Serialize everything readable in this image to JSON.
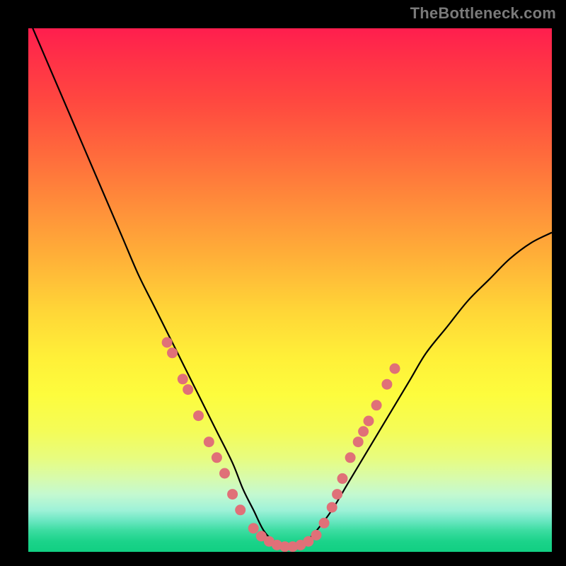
{
  "watermark": "TheBottleneck.com",
  "colors": {
    "watermark_text": "#7a7a7a",
    "frame_background": "#000000",
    "curve_stroke": "#000000",
    "dot_fill": "#e07078",
    "gradient_stops": [
      "#ff1e4e",
      "#ff3147",
      "#ff4840",
      "#ff6a3c",
      "#ff8e3a",
      "#ffb138",
      "#ffd637",
      "#fff038",
      "#fdfc3d",
      "#f4fc58",
      "#e8fc7e",
      "#d7fbad",
      "#c4f9d0",
      "#9ff2d8",
      "#6ce7c2",
      "#3adca0",
      "#1bd38a",
      "#11cf82"
    ]
  },
  "chart_data": {
    "type": "line",
    "title": "",
    "xlabel": "",
    "ylabel": "",
    "xlim": [
      0,
      100
    ],
    "ylim": [
      0,
      100
    ],
    "grid": false,
    "legend": false,
    "series": [
      {
        "name": "bottleneck-curve",
        "x": [
          0,
          3,
          6,
          9,
          12,
          15,
          18,
          21,
          24,
          27,
          30,
          33,
          36,
          39,
          41,
          43,
          45,
          47,
          49,
          51,
          53,
          55,
          58,
          61,
          64,
          67,
          70,
          73,
          76,
          80,
          84,
          88,
          92,
          96,
          100
        ],
        "y": [
          102,
          95,
          88,
          81,
          74,
          67,
          60,
          53,
          47,
          41,
          35,
          29,
          23,
          17,
          12,
          8,
          4,
          2,
          1,
          1,
          2,
          4,
          8,
          13,
          18,
          23,
          28,
          33,
          38,
          43,
          48,
          52,
          56,
          59,
          61
        ]
      }
    ],
    "markers": [
      {
        "x": 26.5,
        "y": 40
      },
      {
        "x": 27.5,
        "y": 38
      },
      {
        "x": 29.5,
        "y": 33
      },
      {
        "x": 30.5,
        "y": 31
      },
      {
        "x": 32.5,
        "y": 26
      },
      {
        "x": 34.5,
        "y": 21
      },
      {
        "x": 36.0,
        "y": 18
      },
      {
        "x": 37.5,
        "y": 15
      },
      {
        "x": 39.0,
        "y": 11
      },
      {
        "x": 40.5,
        "y": 8
      },
      {
        "x": 43.0,
        "y": 4.5
      },
      {
        "x": 44.5,
        "y": 3
      },
      {
        "x": 46.0,
        "y": 2
      },
      {
        "x": 47.5,
        "y": 1.3
      },
      {
        "x": 49.0,
        "y": 1
      },
      {
        "x": 50.5,
        "y": 1
      },
      {
        "x": 52.0,
        "y": 1.3
      },
      {
        "x": 53.5,
        "y": 2
      },
      {
        "x": 55.0,
        "y": 3.2
      },
      {
        "x": 56.5,
        "y": 5.5
      },
      {
        "x": 58.0,
        "y": 8.5
      },
      {
        "x": 59.0,
        "y": 11
      },
      {
        "x": 60.0,
        "y": 14
      },
      {
        "x": 61.5,
        "y": 18
      },
      {
        "x": 63.0,
        "y": 21
      },
      {
        "x": 64.0,
        "y": 23
      },
      {
        "x": 65.0,
        "y": 25
      },
      {
        "x": 66.5,
        "y": 28
      },
      {
        "x": 68.5,
        "y": 32
      },
      {
        "x": 70.0,
        "y": 35
      }
    ]
  }
}
